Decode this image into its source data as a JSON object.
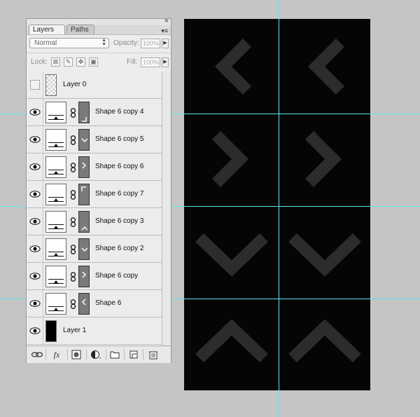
{
  "panel": {
    "tabs": [
      {
        "label": "Layers"
      },
      {
        "label": "Paths"
      }
    ],
    "tab_close_glyph": "×",
    "window_close_glyph": "×",
    "menu_glyph": "▾≡",
    "blend_mode": "Normal",
    "opacity_label": "Opacity:",
    "opacity_value": "100%",
    "lock_label": "Lock:",
    "fill_label": "Fill:",
    "fill_value": "100%",
    "layers": [
      {
        "name": "Layer 0",
        "visible": false,
        "kind": "transparent"
      },
      {
        "name": "Shape 6 copy 4",
        "visible": true,
        "kind": "shape",
        "mask_icon": "arrow-down-right"
      },
      {
        "name": "Shape 6 copy 5",
        "visible": true,
        "kind": "shape",
        "mask_icon": "arrow-down"
      },
      {
        "name": "Shape 6 copy 6",
        "visible": true,
        "kind": "shape",
        "mask_icon": "arrow-right"
      },
      {
        "name": "Shape 6 copy 7",
        "visible": true,
        "kind": "shape",
        "mask_icon": "arrow-up-left"
      },
      {
        "name": "Shape 6 copy 3",
        "visible": true,
        "kind": "shape",
        "mask_icon": "arrow-up"
      },
      {
        "name": "Shape 6 copy 2",
        "visible": true,
        "kind": "shape",
        "mask_icon": "arrow-down"
      },
      {
        "name": "Shape 6 copy",
        "visible": true,
        "kind": "shape",
        "mask_icon": "arrow-right"
      },
      {
        "name": "Shape 6",
        "visible": true,
        "kind": "shape",
        "mask_icon": "arrow-left"
      },
      {
        "name": "Layer 1",
        "visible": true,
        "kind": "black"
      }
    ],
    "footer_icons": [
      "link-layers-icon",
      "fx-icon",
      "add-mask-icon",
      "adjustment-layer-icon",
      "new-group-icon",
      "new-layer-icon",
      "trash-icon"
    ]
  },
  "canvas": {
    "background": "#050505",
    "arrow_color": "#2c2c2c",
    "guide_color": "#5fe4ee",
    "arrows": [
      {
        "direction": "left"
      },
      {
        "direction": "left"
      },
      {
        "direction": "right"
      },
      {
        "direction": "right"
      },
      {
        "direction": "down"
      },
      {
        "direction": "down"
      },
      {
        "direction": "up"
      },
      {
        "direction": "up"
      }
    ]
  }
}
